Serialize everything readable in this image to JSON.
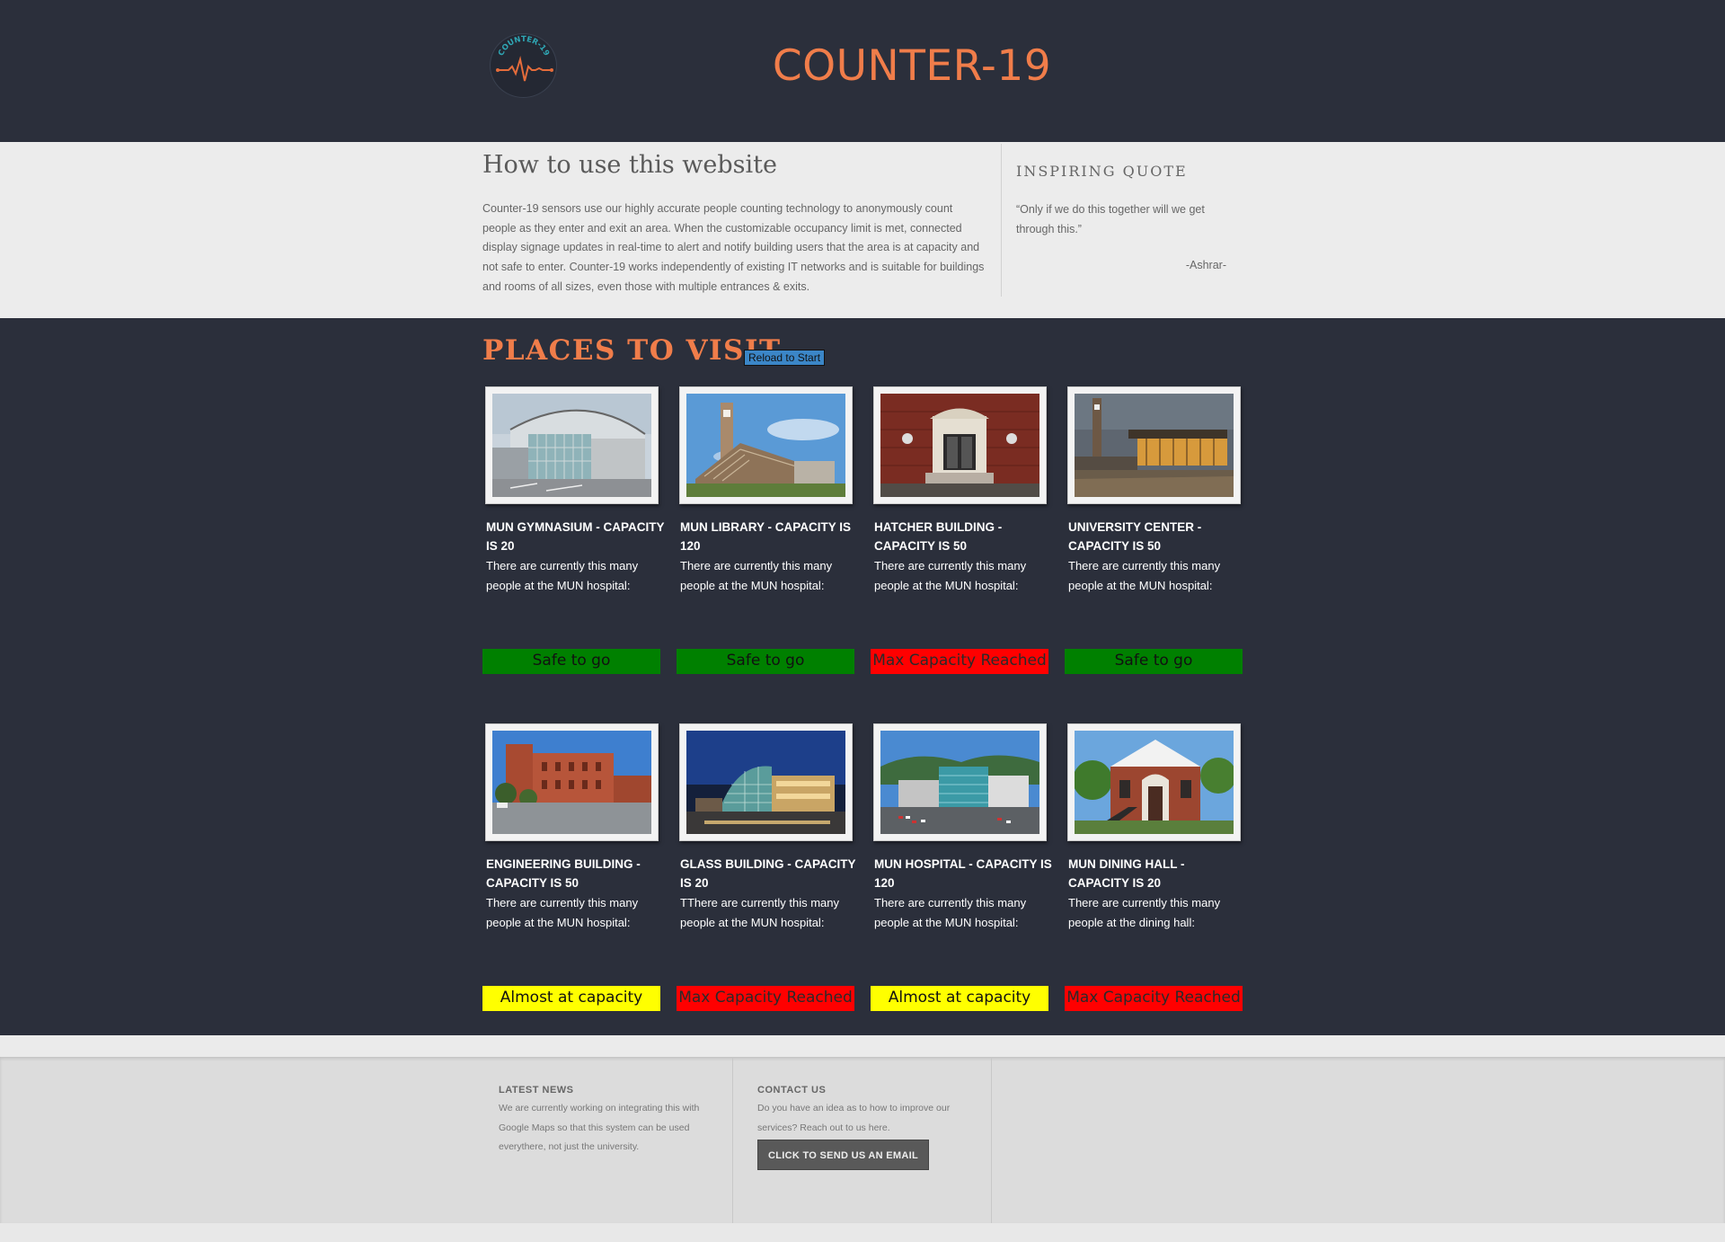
{
  "header": {
    "logo_text": "COUNTER-19",
    "title": "COUNTER-19"
  },
  "intro": {
    "title": "How to use this website",
    "body": "Counter-19 sensors use our highly accurate people counting technology to anonymously count people as they enter and exit an area. When the customizable occupancy limit is met, connected display signage updates in real-time to alert and notify building users that the area is at capacity and not safe to enter. Counter-19 works independently of existing IT networks and is suitable for buildings and rooms of all sizes, even those with multiple entrances & exits.",
    "quote_title": "INSPIRING QUOTE",
    "quote_text": "“Only if we do this together will we get through this.”",
    "quote_author": "-Ashrar-"
  },
  "places": {
    "title": "PLACES TO VISIT",
    "reload_label": "Reload to Start",
    "cards": [
      {
        "title": "MUN GYMNASIUM - CAPACITY IS 20",
        "text": "There are currently this many people at the MUN hospital:",
        "status": "Safe to go",
        "status_kind": "safe"
      },
      {
        "title": "MUN LIBRARY - CAPACITY IS 120",
        "text": "There are currently this many people at the MUN hospital:",
        "status": "Safe to go",
        "status_kind": "safe"
      },
      {
        "title": "HATCHER BUILDING - CAPACITY IS 50",
        "text": "There are currently this many people at the MUN hospital:",
        "status": "Max Capacity Reached",
        "status_kind": "max"
      },
      {
        "title": "UNIVERSITY CENTER - CAPACITY IS 50",
        "text": "There are currently this many people at the MUN hospital:",
        "status": "Safe to go",
        "status_kind": "safe"
      },
      {
        "title": "ENGINEERING BUILDING - CAPACITY IS 50",
        "text": "There are currently this many people at the MUN hospital:",
        "status": "Almost at capacity",
        "status_kind": "almost"
      },
      {
        "title": "GLASS BUILDING - CAPACITY IS 20",
        "text": "TThere are currently this many people at the MUN hospital:",
        "status": "Max Capacity Reached",
        "status_kind": "max"
      },
      {
        "title": "MUN HOSPITAL - CAPACITY IS 120",
        "text": "There are currently this many people at the MUN hospital:",
        "status": "Almost at capacity",
        "status_kind": "almost"
      },
      {
        "title": "MUN DINING HALL - CAPACITY IS 20",
        "text": "There are currently this many people at the dining hall:",
        "status": "Max Capacity Reached",
        "status_kind": "max"
      }
    ]
  },
  "footer": {
    "news_title": "LATEST NEWS",
    "news_text": "We are currently working on integrating this with Google Maps so that this system can be used everythere, not just the university.",
    "contact_title": "CONTACT US",
    "contact_text": "Do you have an idea as to how to improve our services? Reach out to us here.",
    "email_button": "CLICK TO SEND US AN EMAIL"
  },
  "colors": {
    "background": "#2b2f3b",
    "accent": "#f07d4a",
    "safe": "#008000",
    "max": "#ff0000",
    "almost": "#ffff00"
  }
}
